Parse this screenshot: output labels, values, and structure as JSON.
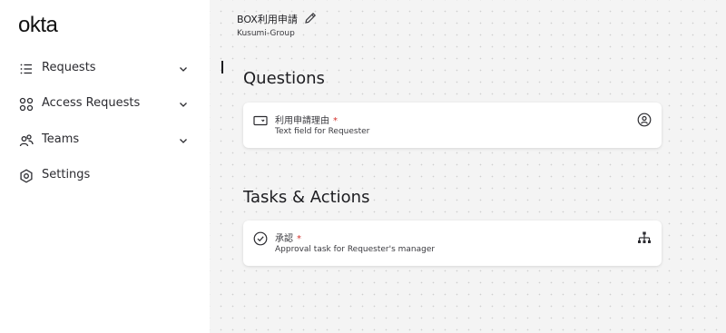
{
  "app": {
    "logo": "okta"
  },
  "sidebar": {
    "items": [
      {
        "label": "Requests",
        "icon": "list-icon",
        "expandable": true
      },
      {
        "label": "Access Requests",
        "icon": "grid-icon",
        "expandable": true
      },
      {
        "label": "Teams",
        "icon": "people-icon",
        "expandable": true
      },
      {
        "label": "Settings",
        "icon": "gear-icon",
        "expandable": false
      }
    ]
  },
  "flow": {
    "title": "BOX利用申請",
    "subtitle": "Kusumi-Group"
  },
  "questions": {
    "heading": "Questions",
    "cards": [
      {
        "title": "利用申請理由",
        "required": "*",
        "subtitle": "Text field for Requester",
        "icon": "textfield-icon",
        "right_icon": "person-circle-icon"
      }
    ]
  },
  "tasks": {
    "heading": "Tasks & Actions",
    "cards": [
      {
        "title": "承認",
        "required": "*",
        "subtitle": "Approval task for Requester's manager",
        "icon": "check-circle-icon",
        "right_icon": "hierarchy-icon"
      }
    ]
  }
}
